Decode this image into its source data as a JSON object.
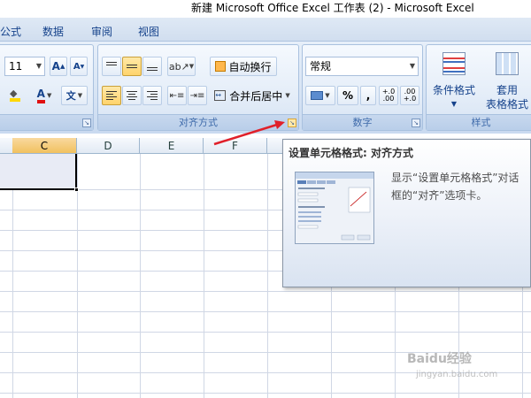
{
  "window": {
    "title": "新建 Microsoft Office Excel 工作表 (2) - Microsoft Excel"
  },
  "menu": {
    "items": [
      "公式",
      "数据",
      "审阅",
      "视图"
    ]
  },
  "ribbon": {
    "font_group": {
      "font_size": "11",
      "grow_font": "A",
      "shrink_font": "A",
      "font_color": "A",
      "phonetic": "文"
    },
    "alignment_group": {
      "label": "对齐方式",
      "wrap_text": "自动换行",
      "merge_center": "合并后居中"
    },
    "number_group": {
      "label": "数字",
      "format": "常规",
      "percent": "%",
      "comma": ",",
      "increase_decimal": "+.0 .00",
      "decrease_decimal": ".00 +.0"
    },
    "styles_group": {
      "label": "样式",
      "conditional_format": "条件格式",
      "table_format_line1": "套用",
      "table_format_line2": "表格格式"
    }
  },
  "sheet": {
    "columns": [
      "C",
      "D",
      "E",
      "F"
    ],
    "selected_column": "C"
  },
  "tooltip": {
    "title": "设置单元格格式: 对齐方式",
    "description": "显示“设置单元格格式”对话框的“对齐”选项卡。"
  },
  "watermark": {
    "text": "Baidu经验",
    "sub": "jingyan.baidu.com"
  },
  "colors": {
    "highlight": "#ffd36b",
    "arrow": "#e0202a",
    "ribbon_text": "#15428b"
  }
}
